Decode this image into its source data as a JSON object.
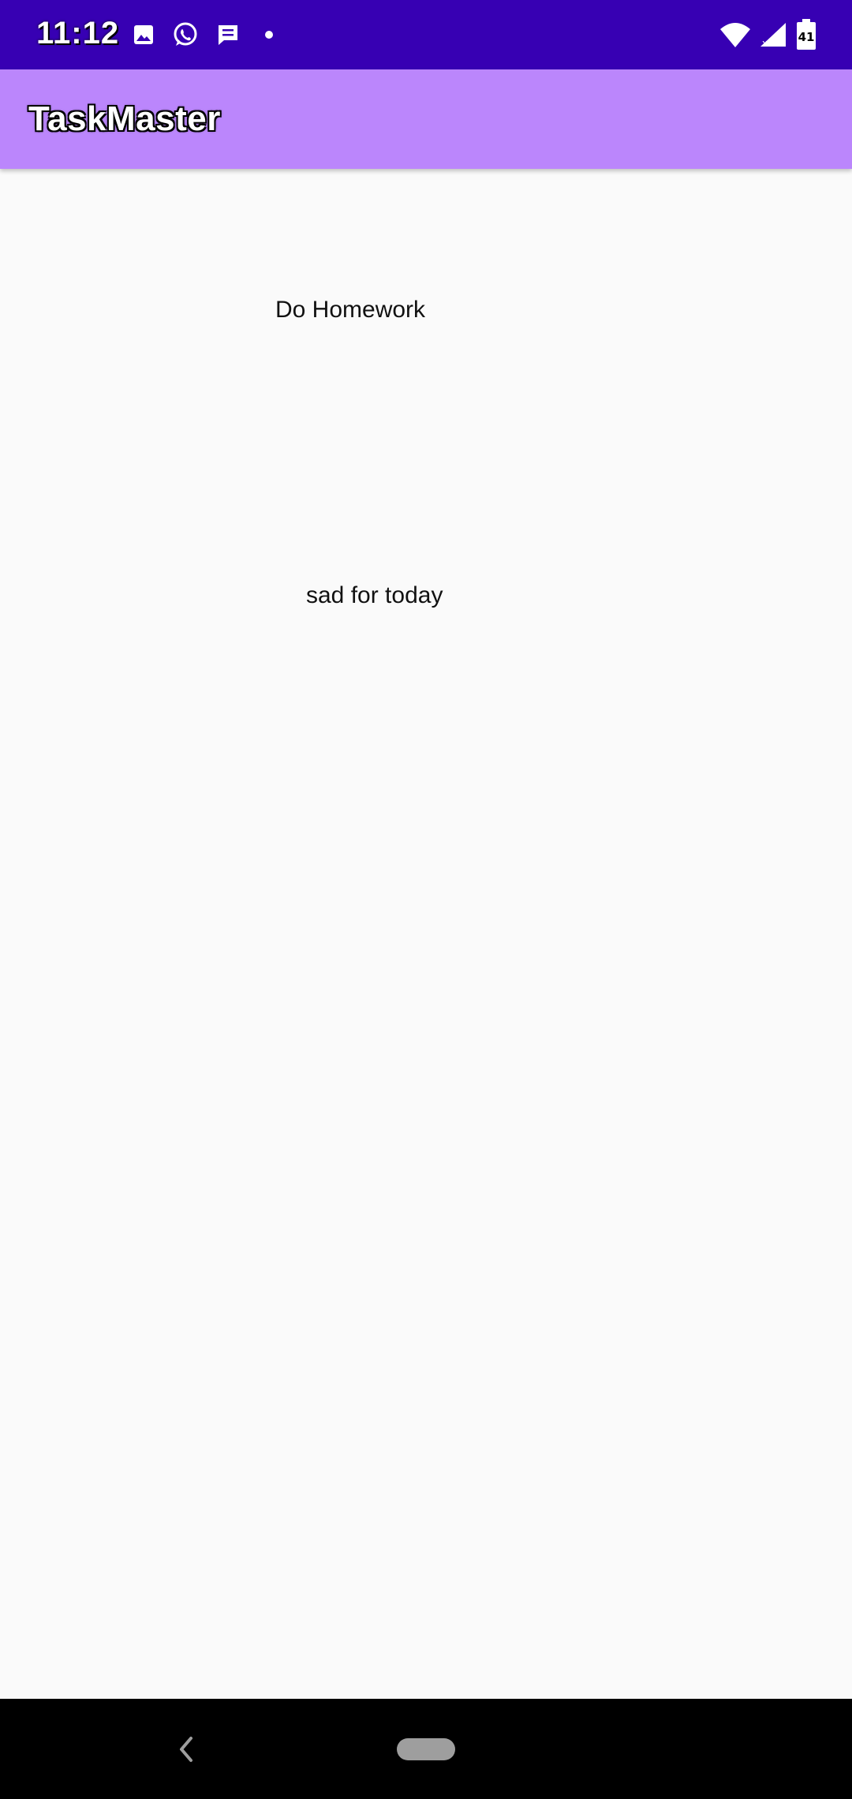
{
  "status_bar": {
    "time": "11:12",
    "left_icons": [
      "image-icon",
      "whatsapp-icon",
      "message-icon",
      "notification-dot-icon"
    ],
    "right_icons": [
      "wifi-icon",
      "signal-icon",
      "battery-icon"
    ],
    "battery_level": "41",
    "background_color": "#3700b3"
  },
  "app_bar": {
    "title": "TaskMaster",
    "background_color": "#bb86fc"
  },
  "tasks": [
    {
      "title": "Do Homework"
    },
    {
      "title": "sad for today"
    }
  ],
  "nav_bar": {
    "icons": [
      "back-icon",
      "home-pill-icon"
    ]
  }
}
